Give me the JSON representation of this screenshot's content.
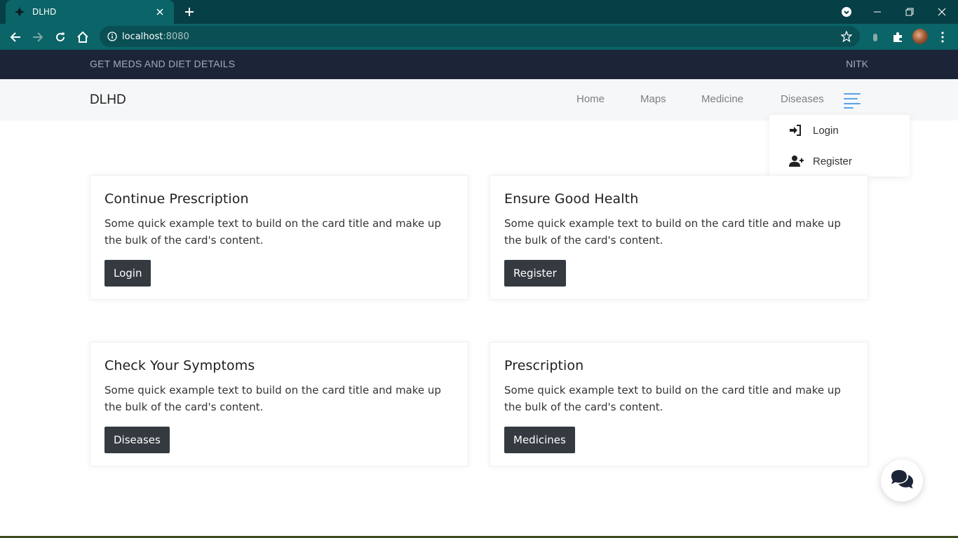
{
  "browser": {
    "tab_title": "DLHD",
    "url_host": "localhost",
    "url_port": ":8080",
    "accent": "#063f45"
  },
  "page": {
    "topbar": {
      "left_text": "GET MEDS AND DIET DETAILS",
      "right_text": "NITK"
    },
    "navbar": {
      "brand": "DLHD",
      "links": [
        "Home",
        "Maps",
        "Medicine",
        "Diseases"
      ]
    },
    "dropdown": {
      "items": [
        {
          "label": "Login",
          "icon": "sign-in-icon"
        },
        {
          "label": "Register",
          "icon": "user-plus-icon"
        }
      ]
    },
    "cards": [
      {
        "title": "Continue Prescription",
        "text": "Some quick example text to build on the card title and make up the bulk of the card's content.",
        "button": "Login"
      },
      {
        "title": "Ensure Good Health",
        "text": "Some quick example text to build on the card title and make up the bulk of the card's content.",
        "button": "Register"
      },
      {
        "title": "Check Your Symptoms",
        "text": "Some quick example text to build on the card title and make up the bulk of the card's content.",
        "button": "Diseases"
      },
      {
        "title": "Prescription",
        "text": "Some quick example text to build on the card title and make up the bulk of the card's content.",
        "button": "Medicines"
      }
    ],
    "chat_icon": "comments-icon"
  }
}
